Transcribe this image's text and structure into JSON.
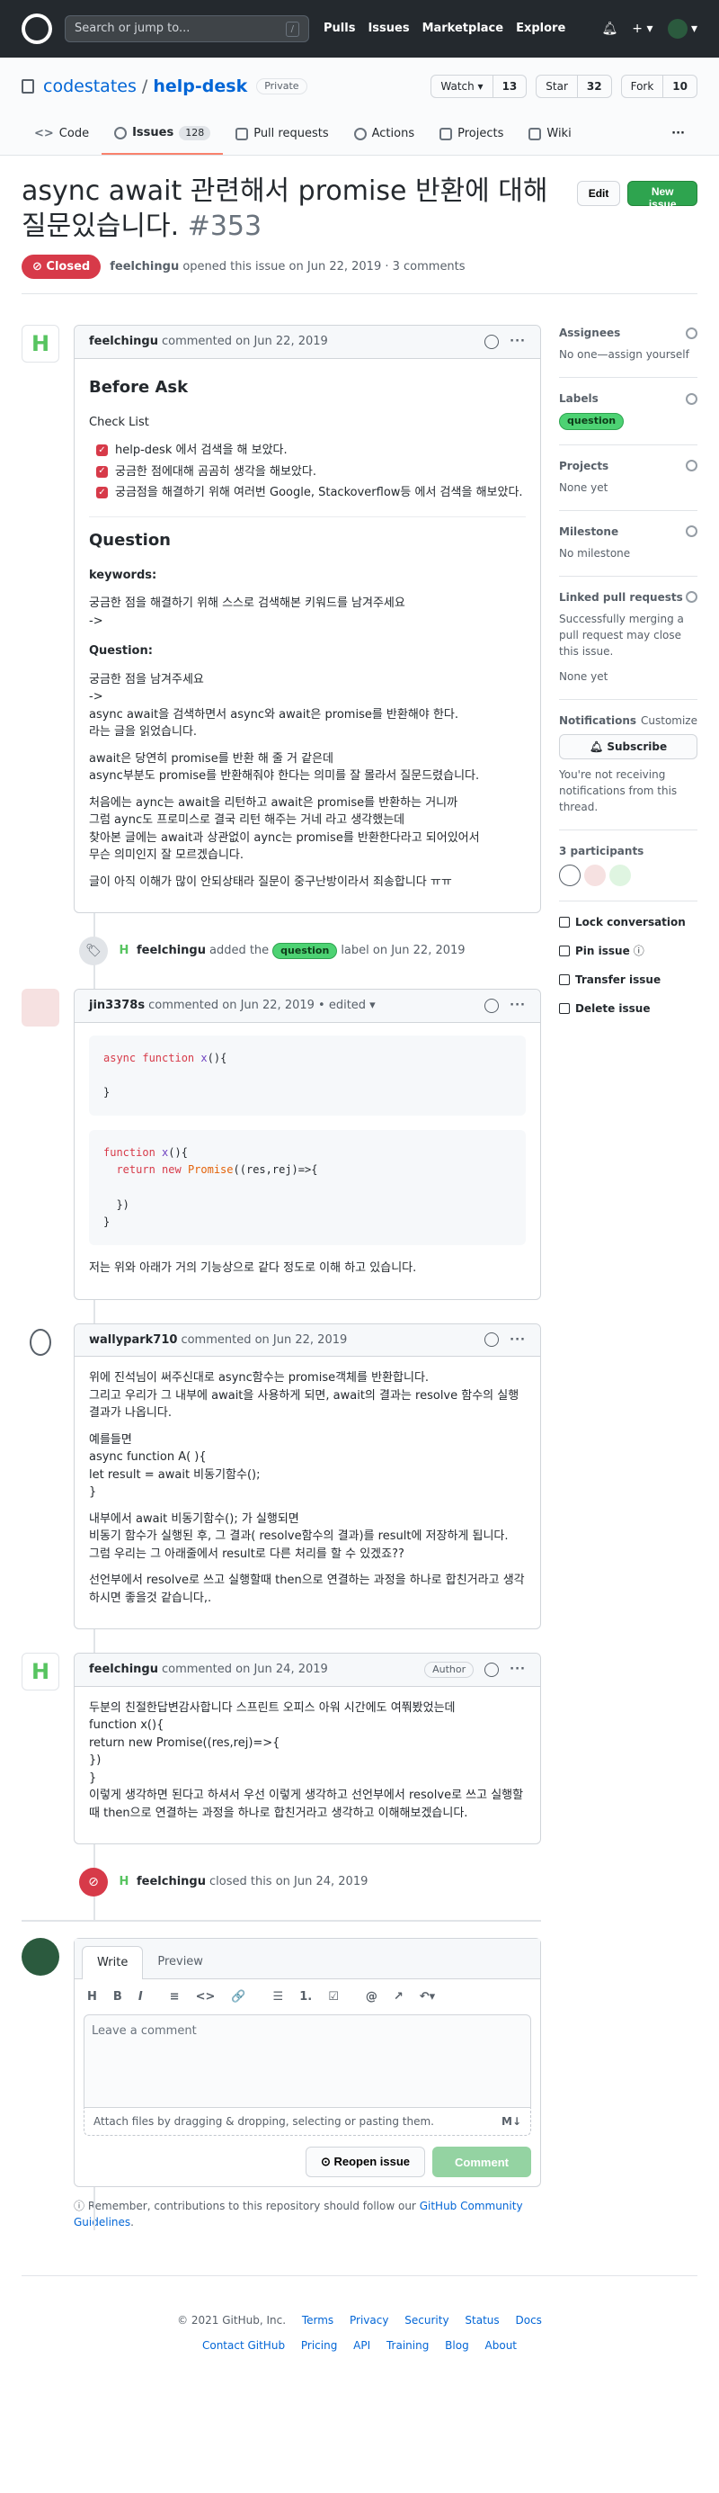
{
  "header": {
    "search_placeholder": "Search or jump to...",
    "search_key": "/",
    "nav": [
      "Pulls",
      "Issues",
      "Marketplace",
      "Explore"
    ],
    "plus": "+ ▾",
    "avatar_caret": "▾"
  },
  "repo": {
    "owner": "codestates",
    "separator": "/",
    "name": "help-desk",
    "visibility": "Private",
    "watch_label": "Watch ▾",
    "watch_count": "13",
    "star_label": "Star",
    "star_count": "32",
    "fork_label": "Fork",
    "fork_count": "10"
  },
  "tabs": {
    "code": "Code",
    "issues": "Issues",
    "issues_count": "128",
    "pulls": "Pull requests",
    "actions": "Actions",
    "projects": "Projects",
    "wiki": "Wiki",
    "more": "···"
  },
  "issue": {
    "title": "async await 관련해서 promise 반환에 대해 질문있습니다.",
    "number": "#353",
    "state": "Closed",
    "edit_button": "Edit",
    "new_issue_button": "New issue",
    "author": "feelchingu",
    "meta": "opened this issue on Jun 22, 2019 · 3 comments"
  },
  "comments": {
    "c1": {
      "author": "feelchingu",
      "date": "commented on Jun 22, 2019",
      "heading": "Before Ask",
      "checklist_title": "Check List",
      "checklist": [
        "help-desk 에서 검색을 해 보았다.",
        "궁금한 점에대해 곰곰히 생각을 해보았다.",
        "궁금점을 해결하기 위해 여러번 Google, Stackoverflow등 에서 검색을 해보았다."
      ],
      "question_heading": "Question",
      "keywords_title": "keywords:",
      "keywords_text": "궁금한 점을 해결하기 위해 스스로 검색해본 키워드를 남겨주세요",
      "keywords_arrow": "->",
      "question_title": "Question:",
      "q_lines1": "궁금한 점을 남겨주세요",
      "q_arrow": "->",
      "q_line2": "async await을 검색하면서 async와 await은 promise를 반환해야 한다.",
      "q_line3": "라는 글을 읽었습니다.",
      "q_line4": "await은 당연히 promise를 반환 해 줄 거 같은데",
      "q_line5": "async부분도 promise를 반환해줘야 한다는 의미를 잘 몰라서 질문드렸습니다.",
      "q_line6": "처음에는 aync는 await을 리턴하고 await은 promise를 반환하는 거니까",
      "q_line7": "그럼 aync도 프로미스로 결국 리턴 해주는 거네 라고 생각했는데",
      "q_line8": "찾아본 글에는 await과 상관없이 aync는 promise를 반환한다라고 되어있어서",
      "q_line9": "무슨 의미인지 잘 모르겠습니다.",
      "q_line10": "글이 아직 이해가 많이 안되상태라 질문이 중구난방이라서 죄송합니다 ㅠㅠ"
    },
    "event_label": {
      "author": "feelchingu",
      "added": "added the",
      "label": "question",
      "suffix": "label on Jun 22, 2019"
    },
    "c2": {
      "author": "jin3378s",
      "date": "commented on Jun 22, 2019 • edited ▾",
      "code1_kw": "async function",
      "code1_fn": "x",
      "code1_rest": "(){",
      "code1_close": "}",
      "code2_kw": "function",
      "code2_fn": "x",
      "code2_open": "(){",
      "code2_return": "return new",
      "code2_type": "Promise",
      "code2_args": "((res,rej)=>{",
      "code2_inner_close": "})",
      "code2_close": "}",
      "text": "저는 위와 아래가 거의 기능상으로 같다 정도로 이해 하고 있습니다."
    },
    "c3": {
      "author": "wallypark710",
      "date": "commented on Jun 22, 2019",
      "p1a": "위에 진석님이 써주신대로 async함수는 promise객체를 반환합니다.",
      "p1b": "그리고 우리가 그 내부에 await을 사용하게 되면, await의 결과는 resolve 함수의 실행 결과가 나옵니다.",
      "p2a": "예를들면",
      "p2b": "async function A( ){",
      "p2c": "let result = await 비동기함수();",
      "p2d": "}",
      "p3a": "내부에서 await 비동기함수(); 가 실행되면",
      "p3b": "비동기 함수가 실행된 후, 그 결과( resolve함수의 결과)를 result에 저장하게 됩니다.",
      "p3c": "그럼 우리는 그 아래줄에서 result로 다른 처리를 할 수 있겠죠??",
      "p4": "선언부에서 resolve로 쓰고 실행할때 then으로 연결하는 과정을 하나로 합친거라고 생각하시면 좋을것 같습니다,."
    },
    "c4": {
      "author": "feelchingu",
      "date": "commented on Jun 24, 2019",
      "badge": "Author",
      "l1": "두분의 친절한답변감사합니다 스프린트 오피스 아워 시간에도 여쭤봤었는데",
      "l2": "function x(){",
      "l3": "return new Promise((res,rej)=>{",
      "l4": "})",
      "l5": "}",
      "l6": "이렇게 생각하면 된다고 하셔서 우선 이렇게 생각하고 선언부에서 resolve로 쓰고 실행할때 then으로 연결하는 과정을 하나로 합친거라고 생각하고 이해해보겠습니다."
    },
    "event_closed": {
      "author": "feelchingu",
      "text": "closed this on Jun 24, 2019"
    }
  },
  "composer": {
    "tab_write": "Write",
    "tab_preview": "Preview",
    "toolbar": [
      "H",
      "B",
      "I",
      "≡",
      "<>",
      "🔗",
      "☰",
      "1.",
      "☑",
      "@",
      "↗",
      "↶▾"
    ],
    "placeholder": "Leave a comment",
    "attach": "Attach files by dragging & dropping, selecting or pasting them.",
    "md_icon": "M↓",
    "reopen": "Reopen issue",
    "comment": "Comment",
    "remember_prefix": "Remember, contributions to this repository should follow our",
    "remember_link": "GitHub Community Guidelines",
    "remember_suffix": "."
  },
  "sidebar": {
    "assignees_title": "Assignees",
    "assignees_text": "No one—assign yourself",
    "labels_title": "Labels",
    "label": "question",
    "projects_title": "Projects",
    "projects_text": "None yet",
    "milestone_title": "Milestone",
    "milestone_text": "No milestone",
    "linked_title": "Linked pull requests",
    "linked_text": "Successfully merging a pull request may close this issue.",
    "linked_none": "None yet",
    "notifications_title": "Notifications",
    "customize": "Customize",
    "subscribe": "Subscribe",
    "notif_text": "You're not receiving notifications from this thread.",
    "participants": "3 participants",
    "lock": "Lock conversation",
    "pin": "Pin issue",
    "transfer": "Transfer issue",
    "delete": "Delete issue"
  },
  "footer": {
    "copyright": "© 2021 GitHub, Inc.",
    "row1": [
      "Terms",
      "Privacy",
      "Security",
      "Status",
      "Docs"
    ],
    "row2": [
      "Contact GitHub",
      "Pricing",
      "API",
      "Training",
      "Blog",
      "About"
    ]
  },
  "colors": {
    "header_bg": "#24292e",
    "closed_red": "#d73a49",
    "green": "#2ea44f",
    "link_blue": "#0366d6",
    "label_green": "#4dd273"
  }
}
